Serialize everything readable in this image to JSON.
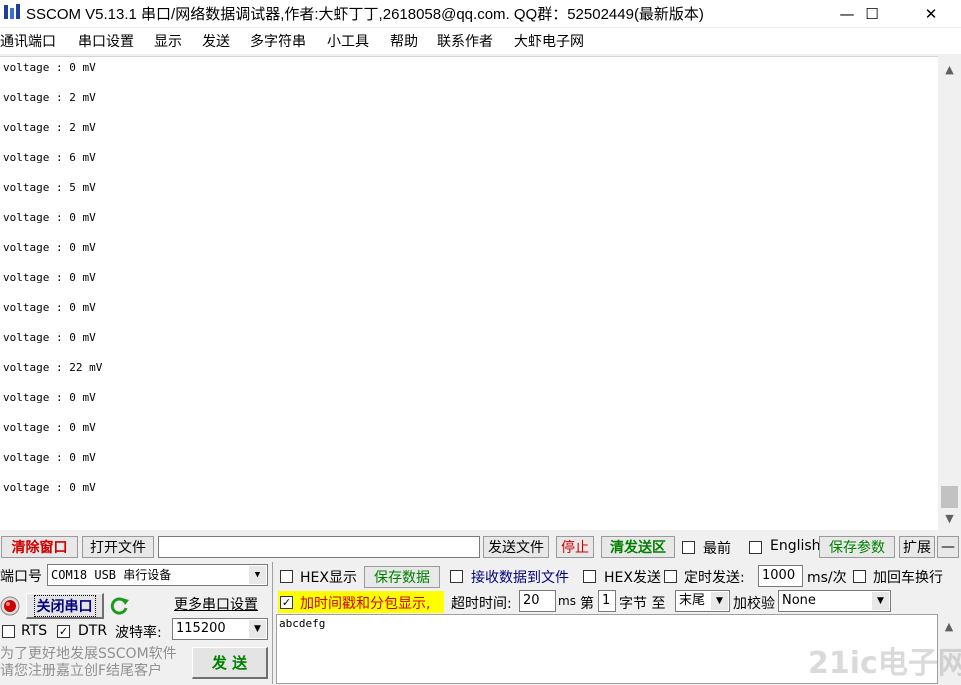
{
  "window": {
    "title": "SSCOM V5.13.1 串口/网络数据调试器,作者:大虾丁丁,2618058@qq.com. QQ群：52502449(最新版本)",
    "minimize": "—",
    "maximize": "☐",
    "close": "✕"
  },
  "menu": [
    "通讯端口",
    "串口设置",
    "显示",
    "发送",
    "多字符串",
    "小工具",
    "帮助",
    "联系作者",
    "大虾电子网"
  ],
  "receive": {
    "lines": [
      "voltage : 0 mV",
      "voltage : 2 mV",
      "voltage : 2 mV",
      "voltage : 6 mV",
      "voltage : 5 mV",
      "voltage : 0 mV",
      "voltage : 0 mV",
      "voltage : 0 mV",
      "voltage : 0 mV",
      "voltage : 0 mV",
      "voltage : 22 mV",
      "voltage : 0 mV",
      "voltage : 0 mV",
      "voltage : 0 mV",
      "voltage : 0 mV"
    ]
  },
  "toolbar": {
    "clear_window": "清除窗口",
    "open_file": "打开文件",
    "file_path": "",
    "send_file": "发送文件",
    "stop": "停止",
    "clear_send": "清发送区",
    "topmost": "最前",
    "english": "English",
    "save_params": "保存参数",
    "expand": "扩展",
    "collapse": "—"
  },
  "port": {
    "port_label": "端口号",
    "port_value": "COM18 USB 串行设备",
    "close_port": "关闭串口",
    "more_settings": "更多串口设置",
    "rts": "RTS",
    "dtr": "DTR",
    "dtr_checked": true,
    "rts_checked": false,
    "baud_label": "波特率:",
    "baud_value": "115200",
    "promo_line1": "为了更好地发展SSCOM软件",
    "promo_line2": "请您注册嘉立创F结尾客户",
    "send": "发  送"
  },
  "options": {
    "hex_display": "HEX显示",
    "save_data": "保存数据",
    "recv_to_file": "接收数据到文件",
    "hex_send": "HEX发送",
    "timed_send": "定时发送:",
    "timed_interval": "1000",
    "interval_unit": "ms/次",
    "add_crlf": "加回车换行",
    "timestamp": "加时间戳和分包显示,",
    "timestamp_checked": true,
    "timeout_label": "超时时间:",
    "timeout_value": "20",
    "timeout_unit": "ms",
    "nth_label": "第",
    "nth_value": "1",
    "byte_label": "字节 至",
    "end_value": "末尾",
    "checksum_label": "加校验",
    "checksum_value": "None"
  },
  "send_area": {
    "text": "abcdefg"
  },
  "watermark": "21ic电子网",
  "colors": {
    "accent_red": "#d00000",
    "accent_green": "#008000",
    "highlight_yellow": "#ffff00",
    "recv_bg": "#ffffff"
  },
  "icons": {
    "app": "sscom-app-icon",
    "port_status": "red-led-icon",
    "refresh": "green-refresh-icon"
  }
}
